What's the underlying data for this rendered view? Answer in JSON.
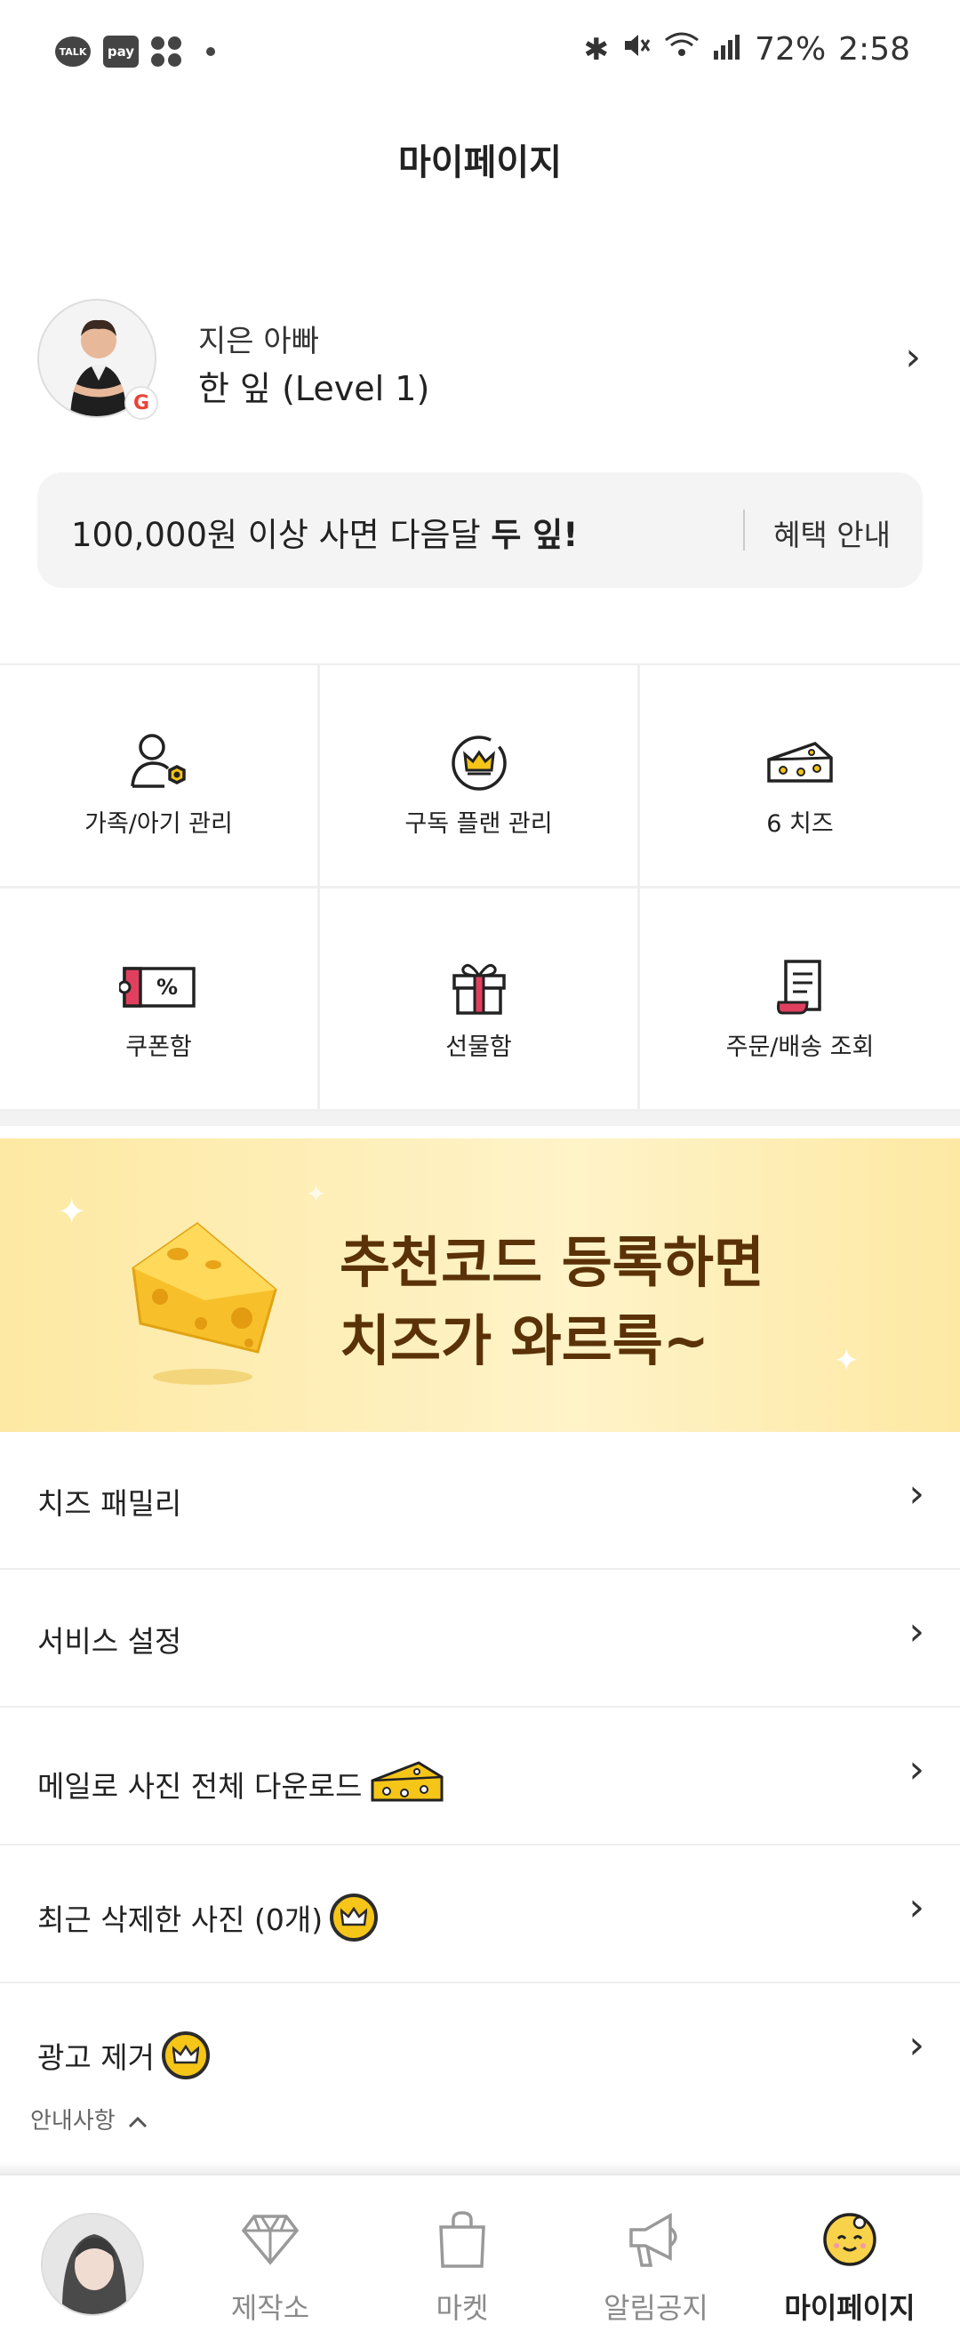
{
  "status_bar": {
    "talk_label": "TALK",
    "pay_label": "pay",
    "battery": "72%",
    "time": "2:58"
  },
  "header": {
    "title": "마이페이지"
  },
  "profile": {
    "name": "지은 아빠",
    "level": "한 잎 (Level 1)",
    "login_provider_badge": "G"
  },
  "benefit": {
    "text_prefix": "100,000원 이상 사면 다음달 ",
    "text_bold": "두 잎!",
    "button_label": "혜택 안내"
  },
  "menu_grid": [
    {
      "label": "가족/아기 관리",
      "icon": "family-gear-icon"
    },
    {
      "label": "구독 플랜 관리",
      "icon": "crown-icon"
    },
    {
      "label": "6 치즈",
      "icon": "cheese-icon"
    },
    {
      "label": "쿠폰함",
      "icon": "coupon-icon"
    },
    {
      "label": "선물함",
      "icon": "gift-icon"
    },
    {
      "label": "주문/배송 조회",
      "icon": "receipt-icon"
    }
  ],
  "promo": {
    "line1": "추천코드 등록하면",
    "line2": "치즈가 와르륵~"
  },
  "list": [
    {
      "label": "치즈 패밀리"
    },
    {
      "label": "서비스 설정"
    },
    {
      "label": "메일로 사진 전체 다운로드"
    },
    {
      "label": "최근 삭제한 사진 (0개)"
    },
    {
      "label": "광고 제거"
    }
  ],
  "notice": {
    "label": "안내사항"
  },
  "bottom_nav": [
    {
      "label": "제작소",
      "icon": "diamond-icon"
    },
    {
      "label": "마켓",
      "icon": "shopping-bag-icon"
    },
    {
      "label": "알림공지",
      "icon": "megaphone-icon"
    },
    {
      "label": "마이페이지",
      "icon": "cheese-face-icon",
      "active": true
    }
  ],
  "colors": {
    "accent_yellow": "#F5C518",
    "promo_text": "#5B3208",
    "coupon_pink": "#E0405E"
  }
}
